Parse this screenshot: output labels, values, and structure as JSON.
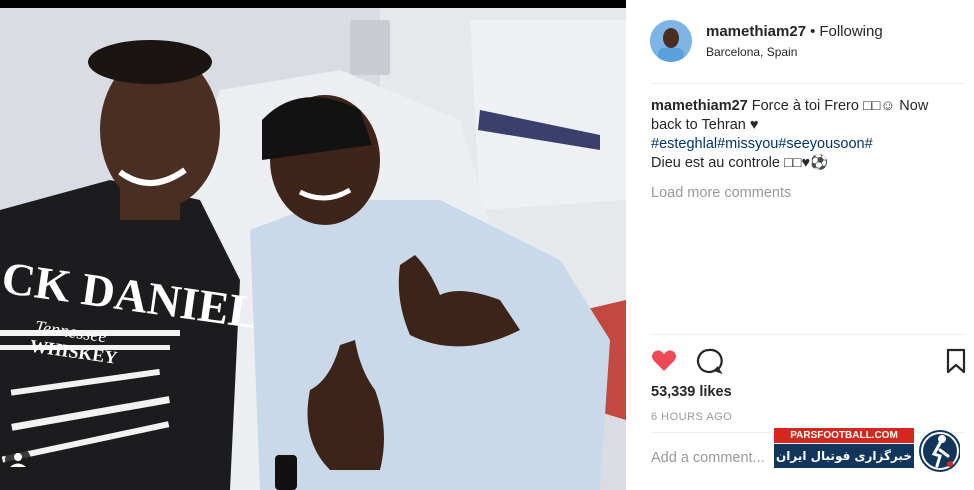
{
  "post": {
    "username": "mamethiam27",
    "separator": "•",
    "follow_status": "Following",
    "location": "Barcelona, Spain",
    "caption": {
      "username": "mamethiam27",
      "text_1": "Force à toi Frero □□☺ Now back to Tehran ♥",
      "hashtags": "#esteghlal#missyou#seeyousoon#",
      "text_2": "Dieu est au controle □□♥⚽"
    },
    "load_more": "Load more comments",
    "likes": "53,339 likes",
    "time_ago": "6 HOURS AGO",
    "comment_placeholder": "Add a comment..."
  },
  "photo": {
    "shirt_text_1": "CK DANIEL'S",
    "shirt_text_2": "Tennessee",
    "shirt_text_3": "WHISKEY"
  },
  "watermark": {
    "site": "PARSFOOTBALL.COM",
    "tagline": "خبرگزاری فوتبال ایران"
  },
  "icons": {
    "like": "heart-icon",
    "comment": "comment-icon",
    "save": "bookmark-icon",
    "corner": "user-tag-icon"
  },
  "colors": {
    "like_red": "#ed4956",
    "hashtag": "#003569",
    "muted": "#999999"
  }
}
